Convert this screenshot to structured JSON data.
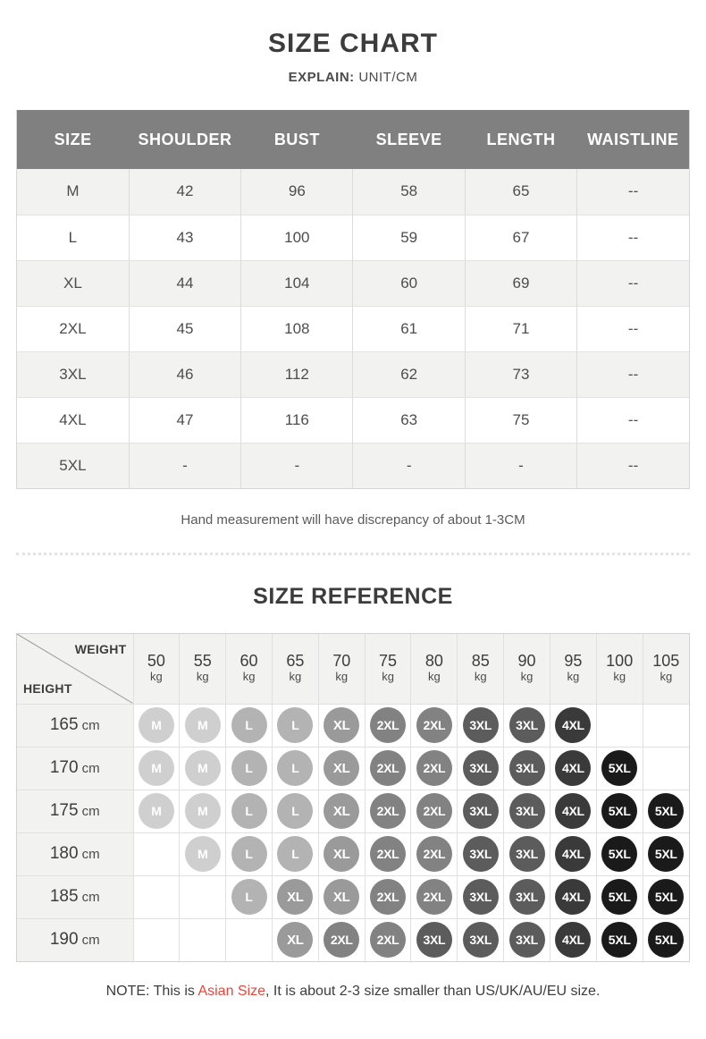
{
  "chart_data": {
    "type": "table",
    "title": "SIZE CHART",
    "subtitle_label": "EXPLAIN:",
    "subtitle_value": "UNIT/CM",
    "columns": [
      "SIZE",
      "SHOULDER",
      "BUST",
      "SLEEVE",
      "LENGTH",
      "WAISTLINE"
    ],
    "rows": [
      [
        "M",
        "42",
        "96",
        "58",
        "65",
        "--"
      ],
      [
        "L",
        "43",
        "100",
        "59",
        "67",
        "--"
      ],
      [
        "XL",
        "44",
        "104",
        "60",
        "69",
        "--"
      ],
      [
        "2XL",
        "45",
        "108",
        "61",
        "71",
        "--"
      ],
      [
        "3XL",
        "46",
        "112",
        "62",
        "73",
        "--"
      ],
      [
        "4XL",
        "47",
        "116",
        "63",
        "75",
        "--"
      ],
      [
        "5XL",
        "-",
        "-",
        "-",
        "-",
        "--"
      ]
    ],
    "note": "Hand measurement will have discrepancy of about 1-3CM"
  },
  "header": {
    "title": "SIZE CHART",
    "explain_label": "EXPLAIN:",
    "explain_value": "UNIT/CM"
  },
  "size_chart": {
    "columns": [
      "SIZE",
      "SHOULDER",
      "BUST",
      "SLEEVE",
      "LENGTH",
      "WAISTLINE"
    ],
    "rows": [
      {
        "size": "M",
        "shoulder": "42",
        "bust": "96",
        "sleeve": "58",
        "length": "65",
        "waistline": "--"
      },
      {
        "size": "L",
        "shoulder": "43",
        "bust": "100",
        "sleeve": "59",
        "length": "67",
        "waistline": "--"
      },
      {
        "size": "XL",
        "shoulder": "44",
        "bust": "104",
        "sleeve": "60",
        "length": "69",
        "waistline": "--"
      },
      {
        "size": "2XL",
        "shoulder": "45",
        "bust": "108",
        "sleeve": "61",
        "length": "71",
        "waistline": "--"
      },
      {
        "size": "3XL",
        "shoulder": "46",
        "bust": "112",
        "sleeve": "62",
        "length": "73",
        "waistline": "--"
      },
      {
        "size": "4XL",
        "shoulder": "47",
        "bust": "116",
        "sleeve": "63",
        "length": "75",
        "waistline": "--"
      },
      {
        "size": "5XL",
        "shoulder": "-",
        "bust": "-",
        "sleeve": "-",
        "length": "-",
        "waistline": "--"
      }
    ],
    "hand_note": "Hand measurement will have discrepancy of about 1-3CM"
  },
  "size_reference": {
    "title": "SIZE REFERENCE",
    "corner": {
      "weight_label": "WEIGHT",
      "height_label": "HEIGHT"
    },
    "weights": [
      {
        "num": "50",
        "unit": "kg"
      },
      {
        "num": "55",
        "unit": "kg"
      },
      {
        "num": "60",
        "unit": "kg"
      },
      {
        "num": "65",
        "unit": "kg"
      },
      {
        "num": "70",
        "unit": "kg"
      },
      {
        "num": "75",
        "unit": "kg"
      },
      {
        "num": "80",
        "unit": "kg"
      },
      {
        "num": "85",
        "unit": "kg"
      },
      {
        "num": "90",
        "unit": "kg"
      },
      {
        "num": "95",
        "unit": "kg"
      },
      {
        "num": "100",
        "unit": "kg"
      },
      {
        "num": "105",
        "unit": "kg"
      }
    ],
    "heights": [
      {
        "num": "165",
        "unit": "cm"
      },
      {
        "num": "170",
        "unit": "cm"
      },
      {
        "num": "175",
        "unit": "cm"
      },
      {
        "num": "180",
        "unit": "cm"
      },
      {
        "num": "185",
        "unit": "cm"
      },
      {
        "num": "190",
        "unit": "cm"
      }
    ],
    "grid": [
      [
        "M",
        "M",
        "L",
        "L",
        "XL",
        "2XL",
        "2XL",
        "3XL",
        "3XL",
        "4XL",
        "",
        ""
      ],
      [
        "M",
        "M",
        "L",
        "L",
        "XL",
        "2XL",
        "2XL",
        "3XL",
        "3XL",
        "4XL",
        "5XL",
        ""
      ],
      [
        "M",
        "M",
        "L",
        "L",
        "XL",
        "2XL",
        "2XL",
        "3XL",
        "3XL",
        "4XL",
        "5XL",
        "5XL"
      ],
      [
        "",
        "M",
        "L",
        "L",
        "XL",
        "2XL",
        "2XL",
        "3XL",
        "3XL",
        "4XL",
        "5XL",
        "5XL"
      ],
      [
        "",
        "",
        "L",
        "XL",
        "XL",
        "2XL",
        "2XL",
        "3XL",
        "3XL",
        "4XL",
        "5XL",
        "5XL"
      ],
      [
        "",
        "",
        "",
        "XL",
        "2XL",
        "2XL",
        "3XL",
        "3XL",
        "3XL",
        "4XL",
        "5XL",
        "5XL"
      ]
    ],
    "bubble_colors": {
      "M": "#cfcfcf",
      "L": "#b3b3b3",
      "XL": "#9a9a9a",
      "2XL": "#828282",
      "3XL": "#5c5c5c",
      "4XL": "#3a3a3a",
      "5XL": "#1a1a1a"
    }
  },
  "footer": {
    "note_prefix": "NOTE: This is ",
    "note_highlight": "Asian Size",
    "note_suffix": ", It is about 2-3 size smaller than US/UK/AU/EU size.",
    "highlight_color": "#f0433a"
  }
}
